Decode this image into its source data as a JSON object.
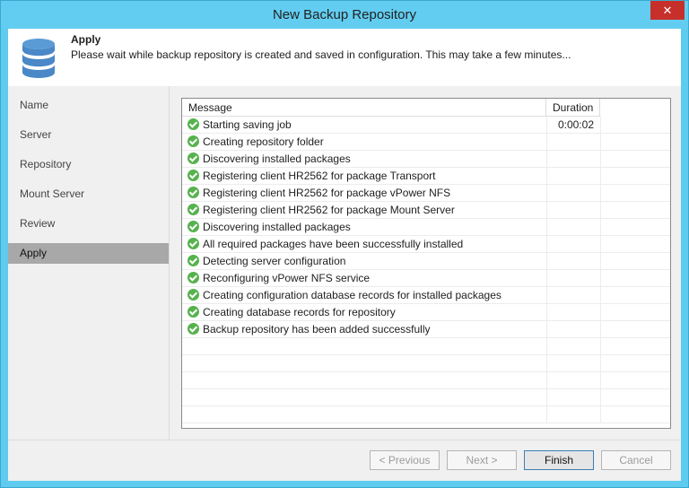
{
  "window": {
    "title": "New Backup Repository",
    "close_glyph": "✕"
  },
  "header": {
    "title": "Apply",
    "description": "Please wait while backup repository is created and saved in configuration. This may take a few minutes..."
  },
  "nav": {
    "items": [
      {
        "label": "Name"
      },
      {
        "label": "Server"
      },
      {
        "label": "Repository"
      },
      {
        "label": "Mount Server"
      },
      {
        "label": "Review"
      },
      {
        "label": "Apply",
        "active": true
      }
    ]
  },
  "log_table": {
    "columns": [
      "Message",
      "Duration"
    ],
    "rows": [
      {
        "message": "Starting saving job",
        "duration": "0:00:02"
      },
      {
        "message": "Creating repository folder",
        "duration": ""
      },
      {
        "message": "Discovering installed packages",
        "duration": ""
      },
      {
        "message": "Registering client HR2562 for package Transport",
        "duration": ""
      },
      {
        "message": "Registering client HR2562 for package vPower NFS",
        "duration": ""
      },
      {
        "message": "Registering client HR2562 for package Mount Server",
        "duration": ""
      },
      {
        "message": "Discovering installed packages",
        "duration": ""
      },
      {
        "message": "All required packages have been successfully installed",
        "duration": ""
      },
      {
        "message": "Detecting server configuration",
        "duration": ""
      },
      {
        "message": "Reconfiguring vPower NFS service",
        "duration": ""
      },
      {
        "message": "Creating configuration database records for installed packages",
        "duration": ""
      },
      {
        "message": "Creating database records for repository",
        "duration": ""
      },
      {
        "message": "Backup repository has been added successfully",
        "duration": ""
      }
    ]
  },
  "buttons": {
    "previous": "< Previous",
    "next": "Next >",
    "finish": "Finish",
    "cancel": "Cancel"
  },
  "colors": {
    "titlebar": "#62cdf0",
    "close": "#c7302a",
    "success": "#57b24e",
    "nav_active": "#a8a8a8"
  },
  "icons": {
    "header": "database-icon",
    "status": "success-check-icon"
  }
}
